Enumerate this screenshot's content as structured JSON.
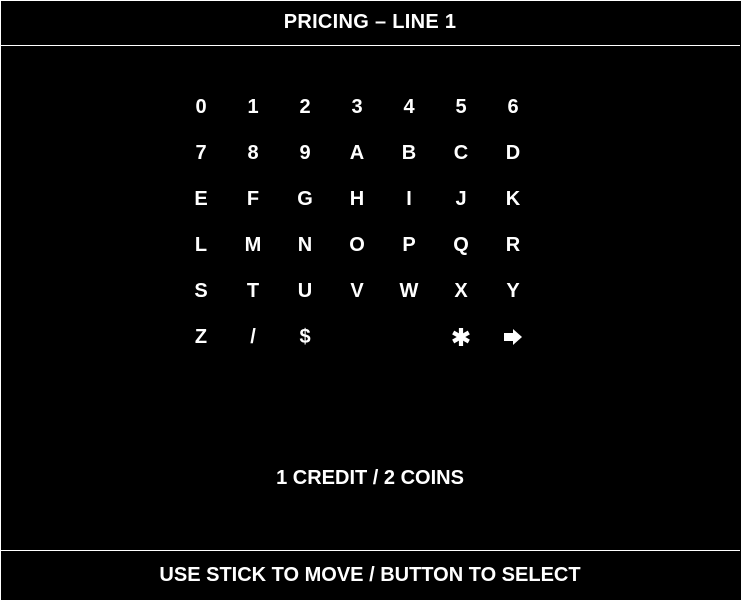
{
  "header": {
    "title": "PRICING – LINE 1"
  },
  "grid": {
    "rows": [
      [
        "0",
        "1",
        "2",
        "3",
        "4",
        "5",
        "6"
      ],
      [
        "7",
        "8",
        "9",
        "A",
        "B",
        "C",
        "D"
      ],
      [
        "E",
        "F",
        "G",
        "H",
        "I",
        "J",
        "K"
      ],
      [
        "L",
        "M",
        "N",
        "O",
        "P",
        "Q",
        "R"
      ],
      [
        "S",
        "T",
        "U",
        "V",
        "W",
        "X",
        "Y"
      ],
      [
        "Z",
        "/",
        "$"
      ]
    ],
    "special_keys": [
      {
        "icon": "asterisk-icon",
        "name": "asterisk-key"
      },
      {
        "icon": "arrow-right-icon",
        "name": "enter-key"
      }
    ]
  },
  "status": {
    "text": "1 CREDIT / 2 COINS"
  },
  "footer": {
    "text": "USE STICK TO MOVE / BUTTON TO SELECT"
  },
  "colors": {
    "background": "#000000",
    "foreground": "#ffffff"
  }
}
